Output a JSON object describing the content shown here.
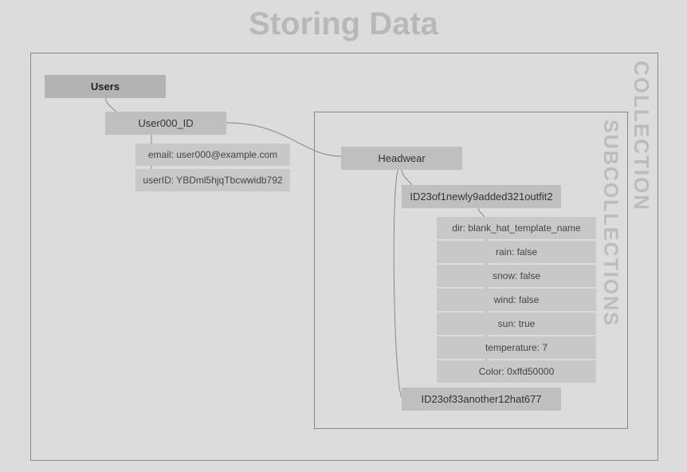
{
  "title": "Storing Data",
  "side_labels": {
    "collection": "COLLECTION",
    "subcollections": "SUBCOLLECTIONS"
  },
  "tree": {
    "users_label": "Users",
    "user_doc": "User000_ID",
    "user_fields": {
      "email": "email: user000@example.com",
      "userid": "userID: YBDml5hjqTbcwwidb792"
    },
    "headwear_label": "Headwear",
    "outfit_docs": {
      "doc1": "ID23of1newly9added321outfit2",
      "doc2": "ID23of33another12hat677"
    },
    "outfit_fields": {
      "dir": "dir: blank_hat_template_name",
      "rain": "rain: false",
      "snow": "snow: false",
      "wind": "wind: false",
      "sun": "sun: true",
      "temp": "temperature: 7",
      "color": "Color: 0xffd50000"
    }
  }
}
